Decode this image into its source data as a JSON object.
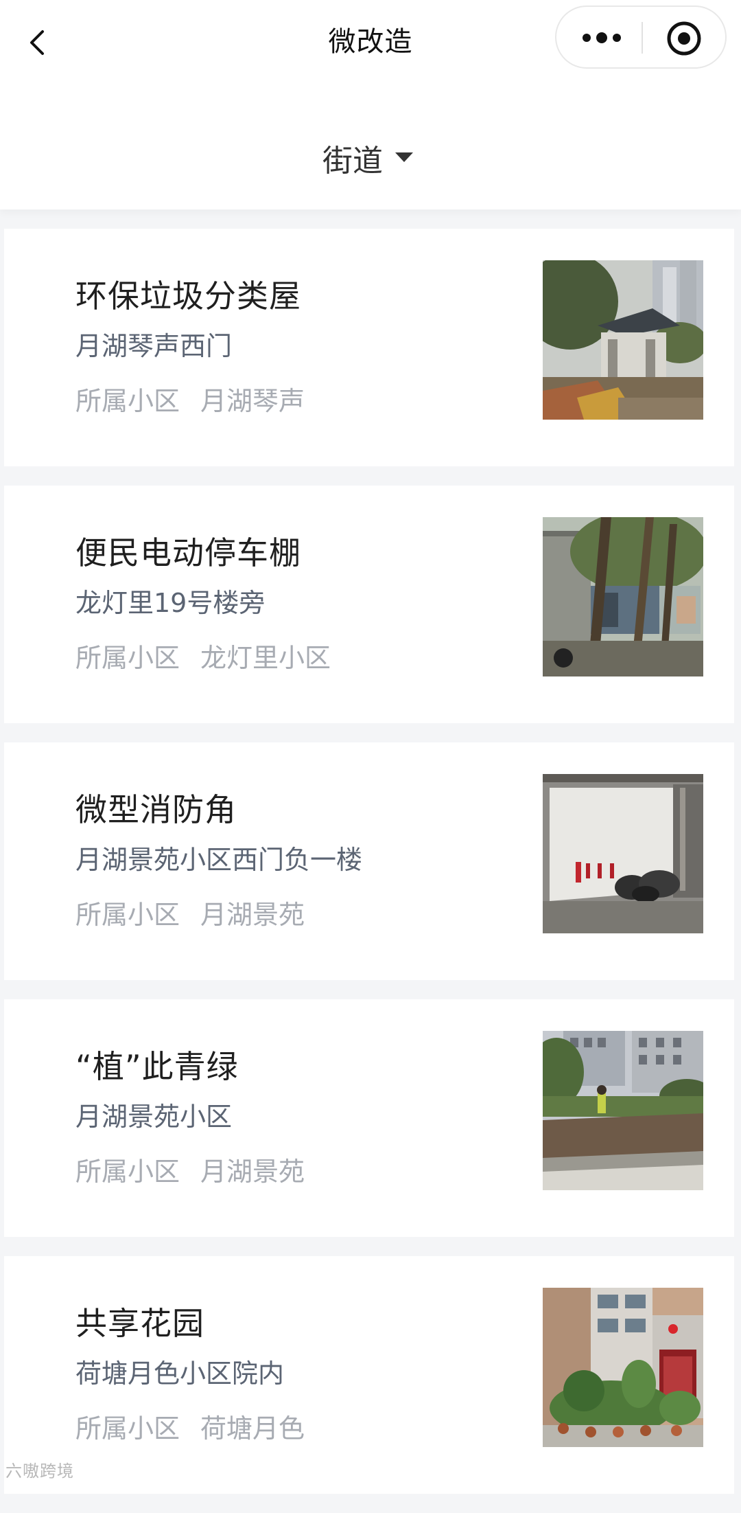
{
  "nav": {
    "title": "微改造",
    "back_icon": "chevron-left-icon",
    "more_icon": "more-dots-icon",
    "target_icon": "target-icon"
  },
  "filter": {
    "label": "街道",
    "icon": "caret-down-icon"
  },
  "items": [
    {
      "title": "环保垃圾分类屋",
      "address": "月湖琴声西门",
      "community_label": "所属小区",
      "community": "月湖琴声",
      "image": "photo of a garbage sorting shed among trees and buildings"
    },
    {
      "title": "便民电动停车棚",
      "address": "龙灯里19号楼旁",
      "community_label": "所属小区",
      "community": "龙灯里小区",
      "image": "photo of an e-bike parking shed beside a wall with trees"
    },
    {
      "title": "微型消防角",
      "address": "月湖景苑小区西门负一楼",
      "community_label": "所属小区",
      "community": "月湖景苑",
      "image": "photo of red fire extinguishers against a white wall in a garage"
    },
    {
      "title": "“植”此青绿",
      "address": "月湖景苑小区",
      "community_label": "所属小区",
      "community": "月湖景苑",
      "image": "photo of a garden bed with a worker planting in front of apartment blocks"
    },
    {
      "title": "共享花园",
      "address": "荷塘月色小区院内",
      "community_label": "所属小区",
      "community": "荷塘月色",
      "image": "photo of potted plants in a courtyard of a residential building"
    }
  ],
  "watermark": "六嗷跨境"
}
